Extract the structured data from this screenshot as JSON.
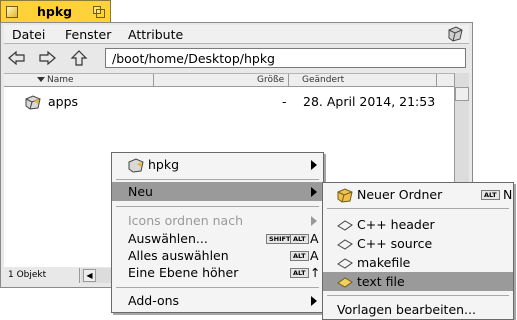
{
  "window": {
    "title": "hpkg"
  },
  "menubar": {
    "items": [
      "Datei",
      "Fenster",
      "Attribute"
    ],
    "package_icon": "package-icon"
  },
  "navigation": {
    "back_icon": "back-arrow-icon",
    "forward_icon": "forward-arrow-icon",
    "up_icon": "up-arrow-icon",
    "path": "/boot/home/Desktop/hpkg"
  },
  "columns": {
    "name": "Name",
    "size": "Größe",
    "modified": "Geändert"
  },
  "files": [
    {
      "name": "apps",
      "size": "-",
      "modified": "28. April 2014, 21:53",
      "icon": "package-folder-icon"
    }
  ],
  "status": {
    "count": "1 Objekt",
    "scroll_left": "◀"
  },
  "context_menu": {
    "items": [
      {
        "label": "hpkg",
        "icon": "package-folder-icon",
        "submenu": true
      },
      {
        "label": "Neu",
        "submenu": true,
        "selected": true
      },
      {
        "label": "Icons ordnen nach",
        "submenu": true,
        "disabled": true
      },
      {
        "label": "Auswählen...",
        "mods": [
          "SHIFT",
          "ALT"
        ],
        "key": "A"
      },
      {
        "label": "Alles auswählen",
        "mods": [
          "ALT"
        ],
        "key": "A"
      },
      {
        "label": "Eine Ebene höher",
        "mods": [
          "ALT"
        ],
        "key": "↑"
      },
      {
        "label": "Add-ons",
        "submenu": true
      }
    ]
  },
  "submenu_neu": {
    "items": [
      {
        "label": "Neuer Ordner",
        "icon": "new-folder-icon",
        "mods": [
          "ALT"
        ],
        "key": "N"
      },
      {
        "label": "C++ header",
        "icon": "document-template-icon"
      },
      {
        "label": "C++ source",
        "icon": "document-template-icon"
      },
      {
        "label": "makefile",
        "icon": "document-template-icon"
      },
      {
        "label": "text file",
        "icon": "document-template-icon",
        "selected": true
      },
      {
        "label": "Vorlagen bearbeiten..."
      }
    ]
  }
}
